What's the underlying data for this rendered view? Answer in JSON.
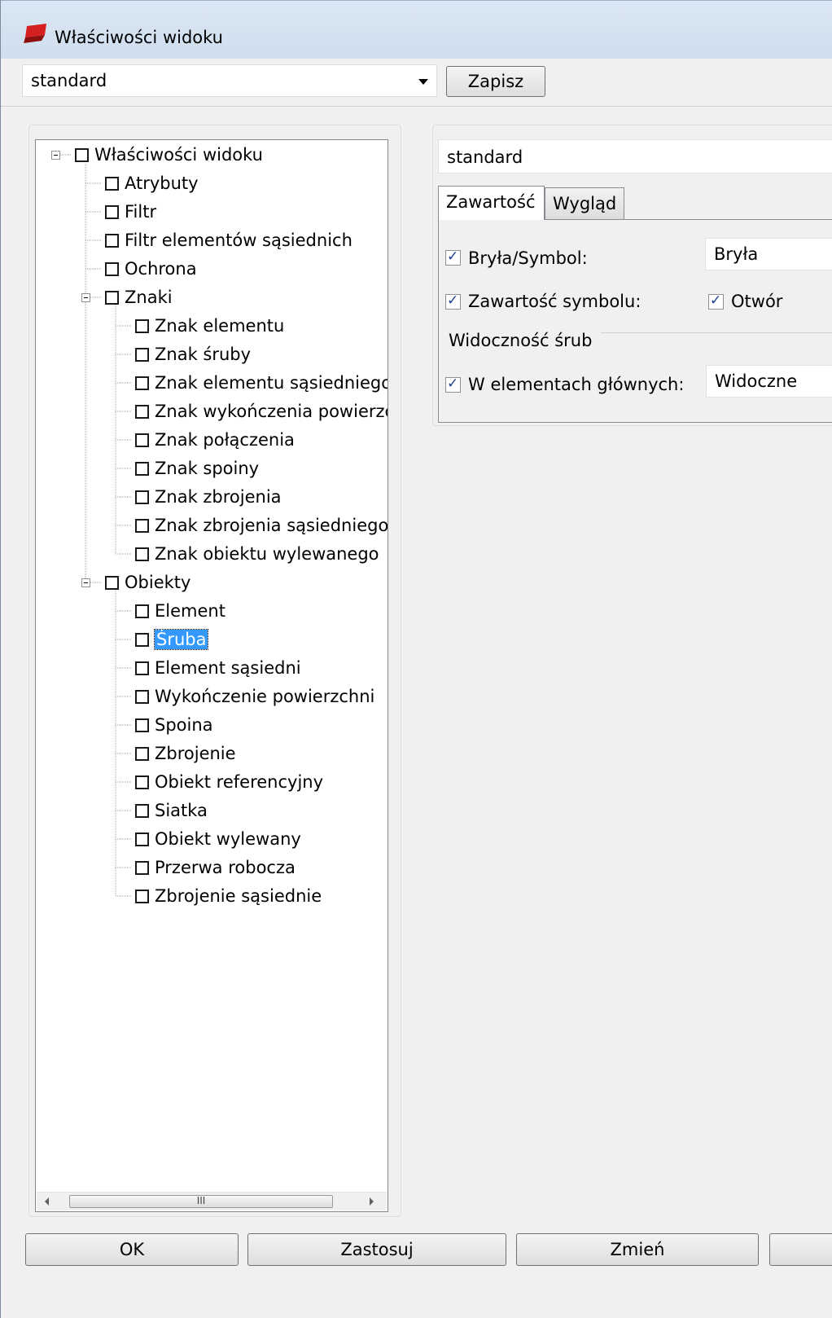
{
  "window": {
    "title": "Właściwości widoku"
  },
  "toolbar": {
    "combo_value": "standard",
    "save_label": "Zapisz"
  },
  "tree": {
    "root": "Właściwości widoku",
    "atrybuty": "Atrybuty",
    "filtr": "Filtr",
    "filtr_sasiednich": "Filtr elementów sąsiednich",
    "ochrona": "Ochrona",
    "znaki": "Znaki",
    "znaki_children": [
      "Znak elementu",
      "Znak śruby",
      "Znak elementu sąsiedniego",
      "Znak wykończenia powierzc",
      "Znak połączenia",
      "Znak spoiny",
      "Znak zbrojenia",
      "Znak zbrojenia sąsiedniego",
      "Znak obiektu wylewanego"
    ],
    "obiekty": "Obiekty",
    "obiekty_children": [
      "Element",
      "Śruba",
      "Element sąsiedni",
      "Wykończenie powierzchni",
      "Spoina",
      "Zbrojenie",
      "Obiekt referencyjny",
      "Siatka",
      "Obiekt wylewany",
      "Przerwa robocza",
      "Zbrojenie sąsiednie"
    ],
    "selected": "Śruba",
    "scroll_thumb_label": "III"
  },
  "panel": {
    "name_value": "standard",
    "tabs": [
      "Zawartość",
      "Wygląd"
    ],
    "active_tab": "Zawartość",
    "bryla_label": "Bryła/Symbol:",
    "bryla_value": "Bryła",
    "zawartosc_label": "Zawartość symbolu:",
    "otwor_label": "Otwór",
    "group_title": "Widoczność śrub",
    "elementy_glowne_label": "W elementach głównych:",
    "elementy_glowne_value": "Widoczne"
  },
  "buttons": {
    "ok": "OK",
    "apply": "Zastosuj",
    "change": "Zmień"
  },
  "colors": {
    "selection": "#3399ff",
    "titlebar": "#d4e1f0",
    "window_bg": "#f0f0f0"
  }
}
